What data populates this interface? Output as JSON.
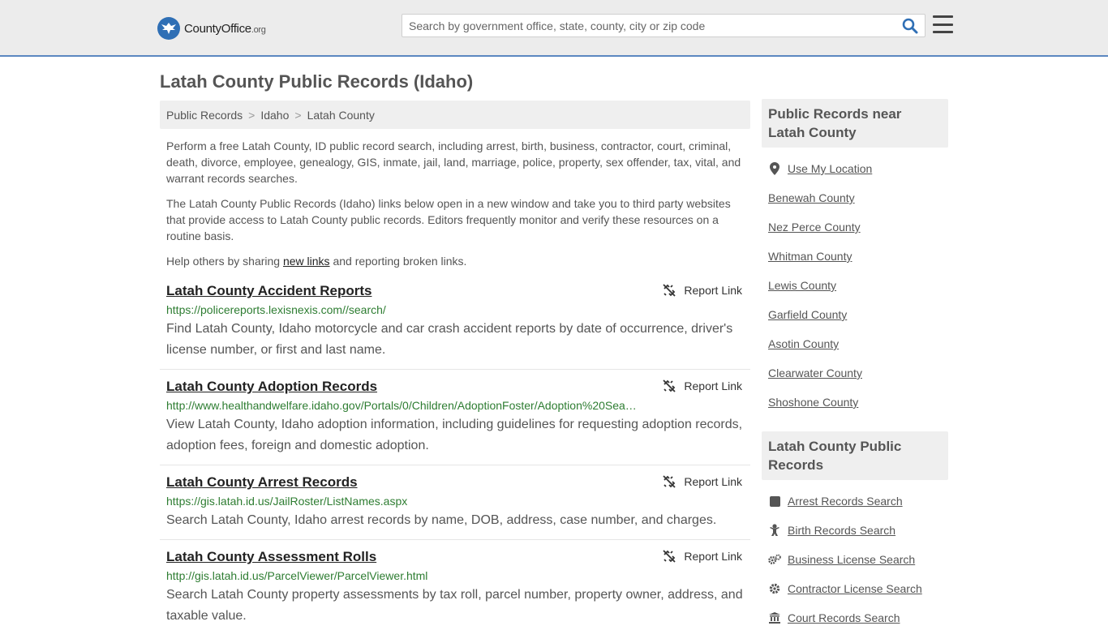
{
  "header": {
    "logo_main": "CountyOffice",
    "logo_suffix": ".org",
    "search_placeholder": "Search by government office, state, county, city or zip code"
  },
  "page": {
    "title": "Latah County Public Records (Idaho)"
  },
  "breadcrumb": {
    "items": [
      "Public Records",
      "Idaho",
      "Latah County"
    ],
    "separator": ">"
  },
  "intro": {
    "p1": "Perform a free Latah County, ID public record search, including arrest, birth, business, contractor, court, criminal, death, divorce, employee, genealogy, GIS, inmate, jail, land, marriage, police, property, sex offender, tax, vital, and warrant records searches.",
    "p2": "The Latah County Public Records (Idaho) links below open in a new window and take you to third party websites that provide access to Latah County public records. Editors frequently monitor and verify these resources on a routine basis.",
    "p3_before": "Help others by sharing ",
    "p3_link": "new links",
    "p3_after": " and reporting broken links."
  },
  "records": [
    {
      "title": "Latah County Accident Reports",
      "url": "https://policereports.lexisnexis.com//search/",
      "description": "Find Latah County, Idaho motorcycle and car crash accident reports by date of occurrence, driver's license number, or first and last name.",
      "report_label": "Report Link"
    },
    {
      "title": "Latah County Adoption Records",
      "url": "http://www.healthandwelfare.idaho.gov/Portals/0/Children/AdoptionFoster/Adoption%20Sea…",
      "description": "View Latah County, Idaho adoption information, including guidelines for requesting adoption records, adoption fees, foreign and domestic adoption.",
      "report_label": "Report Link"
    },
    {
      "title": "Latah County Arrest Records",
      "url": "https://gis.latah.id.us/JailRoster/ListNames.aspx",
      "description": "Search Latah County, Idaho arrest records by name, DOB, address, case number, and charges.",
      "report_label": "Report Link"
    },
    {
      "title": "Latah County Assessment Rolls",
      "url": "http://gis.latah.id.us/ParcelViewer/ParcelViewer.html",
      "description": "Search Latah County property assessments by tax roll, parcel number, property owner, address, and taxable value.",
      "report_label": "Report Link"
    }
  ],
  "sidebar": {
    "nearby_heading": "Public Records near Latah County",
    "use_location": "Use My Location",
    "nearby": [
      "Benewah County",
      "Nez Perce County",
      "Whitman County",
      "Lewis County",
      "Garfield County",
      "Asotin County",
      "Clearwater County",
      "Shoshone County"
    ],
    "records_heading": "Latah County Public Records",
    "record_links": [
      {
        "label": "Arrest Records Search",
        "icon": "square-icon"
      },
      {
        "label": "Birth Records Search",
        "icon": "baby-icon"
      },
      {
        "label": "Business License Search",
        "icon": "gears-icon"
      },
      {
        "label": "Contractor License Search",
        "icon": "gear-icon"
      },
      {
        "label": "Court Records Search",
        "icon": "courthouse-icon"
      }
    ]
  },
  "colors": {
    "brand_blue": "#2f6fb5",
    "url_green": "#2e7d32",
    "header_bg": "#ececec",
    "header_border": "#5b87c0"
  }
}
